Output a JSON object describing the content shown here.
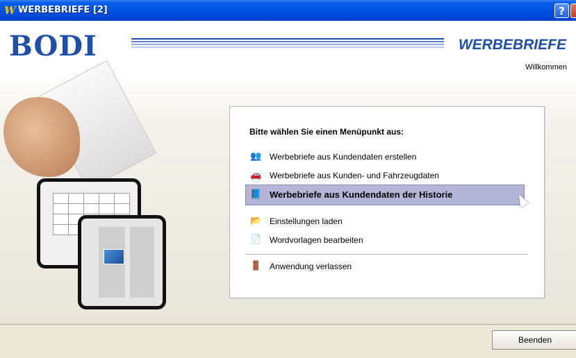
{
  "window": {
    "title": "WERBEBRIEFE [2]",
    "title_icon_glyph": "W",
    "help_label": "?"
  },
  "header": {
    "brand": "BODI",
    "app_name": "WERBEBRIEFE",
    "welcome": "Willkommen"
  },
  "menu": {
    "prompt": "Bitte wählen Sie einen Menüpunkt aus:",
    "items": [
      {
        "label": "Werbebriefe aus Kundendaten erstellen",
        "icon": "customers-icon"
      },
      {
        "label": "Werbebriefe aus Kunden- und Fahrzeugdaten",
        "icon": "vehicle-customers-icon"
      },
      {
        "label": "Werbebriefe aus Kundendaten der Historie",
        "icon": "history-icon",
        "selected": true
      },
      {
        "label": "Einstellungen laden",
        "icon": "folder-icon"
      },
      {
        "label": "Wordvorlagen bearbeiten",
        "icon": "word-document-icon"
      },
      {
        "label": "Anwendung verlassen",
        "icon": "exit-door-icon"
      }
    ]
  },
  "footer": {
    "end_button": "Beenden"
  },
  "colors": {
    "titlebar": "#0055e5",
    "brand_blue": "#1f4fa8",
    "selection": "#b5b5d8"
  }
}
